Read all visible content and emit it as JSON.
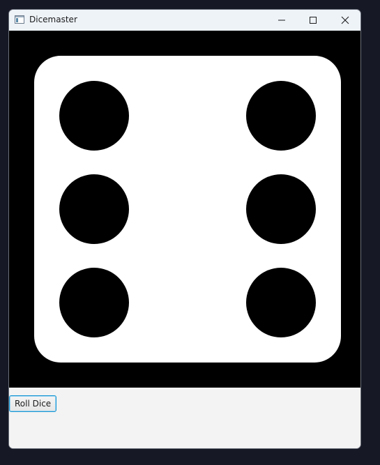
{
  "window": {
    "title": "Dicemaster",
    "icon": "app-window-icon",
    "controls": {
      "minimize_icon": "minimize-icon",
      "maximize_icon": "maximize-icon",
      "close_icon": "close-icon"
    }
  },
  "die": {
    "value": 6,
    "face_color": "#ffffff",
    "pip_color": "#000000",
    "background_color": "#000000"
  },
  "controls": {
    "roll_label": "Roll Dice",
    "accent_color": "#1996d2"
  }
}
